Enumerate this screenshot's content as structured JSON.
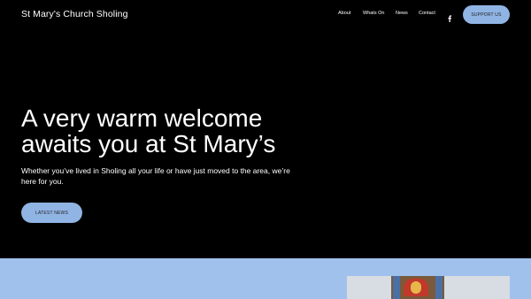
{
  "header": {
    "site_title": "St Mary's Church Sholing",
    "nav": [
      "About",
      "Whats On",
      "News",
      "Contact"
    ],
    "facebook_icon": "facebook-icon",
    "support_label": "SUPPORT US"
  },
  "hero": {
    "headline": "A very warm welcome awaits you at St Mary’s",
    "subtext": "Whether you’ve lived in Sholing all your life or have just moved to the area, we’re here for you.",
    "news_label": "LATEST NEWS"
  },
  "colors": {
    "background": "#000000",
    "accent_button": "#90b4e4",
    "lower_section": "#9fc1ec"
  }
}
